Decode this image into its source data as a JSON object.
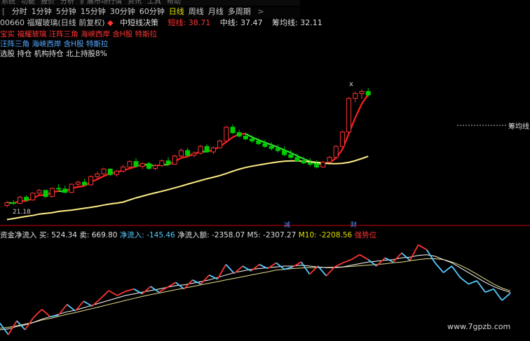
{
  "top_menu": [
    "系统",
    "功能",
    "报价",
    "分析",
    "扩展市场行情",
    "资讯",
    "工具",
    "帮助"
  ],
  "timeframes": {
    "items": [
      "分时",
      "1分钟",
      "5分钟",
      "15分钟",
      "30分钟",
      "60分钟",
      "日线",
      "周线",
      "月线",
      "多周期"
    ],
    "active": "日线",
    "more": ">",
    "leading": "["
  },
  "title": {
    "code": "00660 福耀玻璃(日线 前复权)",
    "indicator_dot": "◆",
    "indicator": "中短线决策",
    "short_label": "短线:",
    "short_value": "38.71",
    "mid_label": "中线:",
    "mid_value": "37.47",
    "chip_label": "筹均线:",
    "chip_value": "32.11"
  },
  "tag_rows": [
    "宝实 福耀玻璃 汪阵三角 海峡西岸 含H股 特斯拉",
    "汪阵三角 海峡西岸 含H股 特斯拉",
    "选股 持仓 机构持仓 北上持股8%"
  ],
  "upper_labels": {
    "chip_line_label": "筹均线",
    "low_price": "21.18",
    "x_mark": "x",
    "event_1": "减",
    "event_2": "财"
  },
  "lower_header": {
    "name": "资金净流入",
    "buy_label": "买:",
    "buy_value": "524.34",
    "sell_label": "卖:",
    "sell_value": "669.80",
    "net_label": "净流入:",
    "net_value": "-145.46",
    "net_total_label": "净流入额:",
    "net_total_value": "-2358.07",
    "m5_label": "M5:",
    "m5_value": "-2307.27",
    "m10_label": "M10:",
    "m10_value": "-2208.56",
    "signal": "强势位"
  },
  "watermark": "www.7gpzb.com",
  "colors": {
    "up": "#ff3333",
    "down": "#00cc00",
    "short_line_up": "#ff2020",
    "short_line_down": "#33dd33",
    "chip_line": "#ffee88",
    "flow_up": "#ff3333",
    "flow_down": "#55ccff",
    "m5": "#ffffff",
    "m10": "#e8e08a",
    "divider": "#cc0000"
  },
  "chart_data": [
    {
      "type": "candlestick",
      "title": "00660 福耀玻璃(日线 前复权)",
      "series": [
        {
          "name": "短线",
          "last": 38.71
        },
        {
          "name": "中线",
          "last": 37.47
        },
        {
          "name": "筹均线",
          "last": 32.11
        }
      ],
      "candles": [
        [
          22.0,
          22.6,
          21.7,
          22.4
        ],
        [
          22.4,
          22.8,
          22.1,
          22.3
        ],
        [
          22.3,
          23.4,
          22.2,
          23.2
        ],
        [
          23.2,
          23.5,
          22.6,
          22.8
        ],
        [
          22.8,
          23.9,
          22.7,
          23.8
        ],
        [
          23.8,
          24.4,
          23.5,
          24.2
        ],
        [
          24.2,
          24.3,
          23.1,
          23.3
        ],
        [
          23.3,
          24.6,
          23.2,
          24.5
        ],
        [
          24.5,
          25.1,
          24.2,
          24.4
        ],
        [
          24.4,
          24.9,
          23.8,
          23.9
        ],
        [
          23.9,
          25.2,
          23.8,
          25.1
        ],
        [
          25.1,
          25.6,
          24.7,
          25.4
        ],
        [
          25.4,
          25.9,
          24.9,
          25.0
        ],
        [
          25.0,
          26.4,
          24.9,
          26.2
        ],
        [
          26.2,
          26.9,
          25.8,
          26.6
        ],
        [
          26.6,
          27.5,
          26.4,
          27.3
        ],
        [
          27.3,
          27.4,
          26.3,
          26.5
        ],
        [
          26.5,
          27.2,
          26.2,
          27.0
        ],
        [
          27.0,
          27.9,
          26.8,
          27.6
        ],
        [
          27.6,
          28.6,
          27.4,
          28.4
        ],
        [
          28.4,
          28.9,
          27.5,
          27.7
        ],
        [
          27.7,
          28.3,
          27.3,
          28.1
        ],
        [
          28.1,
          28.4,
          27.2,
          27.4
        ],
        [
          27.4,
          28.0,
          27.1,
          27.8
        ],
        [
          27.8,
          28.7,
          27.6,
          28.5
        ],
        [
          28.5,
          29.0,
          27.9,
          28.0
        ],
        [
          28.0,
          29.4,
          27.9,
          29.2
        ],
        [
          29.2,
          30.3,
          29.0,
          30.0
        ],
        [
          30.0,
          30.4,
          29.1,
          29.3
        ],
        [
          29.3,
          29.9,
          29.0,
          29.6
        ],
        [
          29.6,
          30.8,
          29.4,
          30.6
        ],
        [
          30.6,
          30.9,
          29.7,
          29.8
        ],
        [
          29.8,
          30.6,
          29.5,
          30.4
        ],
        [
          30.4,
          31.6,
          30.3,
          31.4
        ],
        [
          31.4,
          33.6,
          31.3,
          33.4
        ],
        [
          33.4,
          33.8,
          32.4,
          32.6
        ],
        [
          32.6,
          33.0,
          31.9,
          32.1
        ],
        [
          32.1,
          32.6,
          31.5,
          31.7
        ],
        [
          31.7,
          32.2,
          31.1,
          31.4
        ],
        [
          31.4,
          31.8,
          30.8,
          31.0
        ],
        [
          31.0,
          31.6,
          30.4,
          30.6
        ],
        [
          30.6,
          31.2,
          30.0,
          30.3
        ],
        [
          30.3,
          30.9,
          29.7,
          30.0
        ],
        [
          30.0,
          30.6,
          29.2,
          29.4
        ],
        [
          29.4,
          30.1,
          28.8,
          29.0
        ],
        [
          29.0,
          29.6,
          28.3,
          28.5
        ],
        [
          28.5,
          29.1,
          28.0,
          28.2
        ],
        [
          28.2,
          28.9,
          27.7,
          28.0
        ],
        [
          28.0,
          28.6,
          27.4,
          27.6
        ],
        [
          27.6,
          28.5,
          27.5,
          28.3
        ],
        [
          28.3,
          29.2,
          28.2,
          29.0
        ],
        [
          29.0,
          30.8,
          28.9,
          30.6
        ],
        [
          30.6,
          32.9,
          30.5,
          32.7
        ],
        [
          32.7,
          37.8,
          32.6,
          37.6
        ],
        [
          37.6,
          38.6,
          37.0,
          38.3
        ],
        [
          38.3,
          38.9,
          37.5,
          38.6
        ],
        [
          38.6,
          39.1,
          37.8,
          38.1
        ]
      ]
    },
    {
      "type": "line",
      "title": "资金净流入",
      "series": [
        {
          "name": "净流入额",
          "values": [
            -4200,
            -4900,
            -4050,
            -4600,
            -3850,
            -3350,
            -3800,
            -3700,
            -3050,
            -3450,
            -2850,
            -3150,
            -2700,
            -2200,
            -2500,
            -2250,
            -2100,
            -2400,
            -1950,
            -2300,
            -2000,
            -1700,
            -2100,
            -1550,
            -1800,
            -1250,
            -1500,
            -600,
            -1150,
            -700,
            -1000,
            -600,
            -850,
            -500,
            -900,
            -750,
            -450,
            -1200,
            -700,
            -1300,
            -750,
            -500,
            -300,
            0,
            -300,
            -700,
            -200,
            -450,
            100,
            -350,
            600,
            300,
            -500,
            -1100,
            -700,
            -1400,
            -1800,
            -1600,
            -2300,
            -2100,
            -2800,
            -2358.07
          ]
        },
        {
          "name": "M5",
          "values": [
            -4600,
            -4550,
            -4400,
            -4300,
            -4150,
            -3950,
            -3800,
            -3650,
            -3500,
            -3400,
            -3250,
            -3100,
            -2950,
            -2800,
            -2650,
            -2500,
            -2400,
            -2300,
            -2200,
            -2100,
            -2000,
            -1900,
            -1850,
            -1750,
            -1650,
            -1550,
            -1400,
            -1250,
            -1100,
            -1000,
            -900,
            -850,
            -800,
            -750,
            -700,
            -700,
            -650,
            -700,
            -750,
            -800,
            -800,
            -750,
            -650,
            -550,
            -450,
            -400,
            -350,
            -300,
            -200,
            -150,
            -50,
            0,
            -100,
            -300,
            -500,
            -800,
            -1100,
            -1400,
            -1700,
            -1950,
            -2150,
            -2307.27
          ]
        },
        {
          "name": "M10",
          "values": [
            -4500,
            -4450,
            -4350,
            -4250,
            -4150,
            -4000,
            -3900,
            -3780,
            -3650,
            -3550,
            -3420,
            -3300,
            -3180,
            -3050,
            -2930,
            -2800,
            -2680,
            -2560,
            -2450,
            -2350,
            -2250,
            -2150,
            -2050,
            -1950,
            -1850,
            -1750,
            -1650,
            -1550,
            -1450,
            -1350,
            -1250,
            -1150,
            -1050,
            -950,
            -900,
            -850,
            -820,
            -800,
            -790,
            -780,
            -770,
            -750,
            -720,
            -680,
            -640,
            -600,
            -560,
            -500,
            -450,
            -380,
            -300,
            -250,
            -250,
            -300,
            -450,
            -650,
            -900,
            -1200,
            -1500,
            -1800,
            -2050,
            -2208.56
          ]
        }
      ]
    }
  ]
}
